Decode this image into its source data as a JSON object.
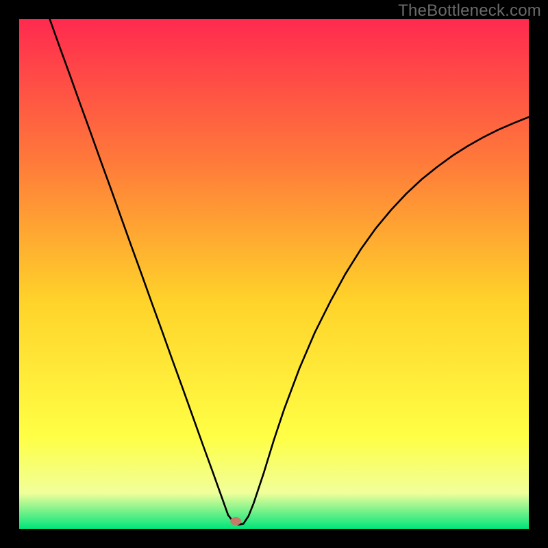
{
  "watermark": "TheBottleneck.com",
  "chart_data": {
    "type": "line",
    "title": "",
    "xlabel": "",
    "ylabel": "",
    "xlim": [
      0,
      100
    ],
    "ylim": [
      0,
      100
    ],
    "grid": false,
    "legend": false,
    "background_gradient": {
      "top": "#ff2a4f",
      "mid_upper": "#ff7a3a",
      "mid": "#ffd22a",
      "mid_lower": "#ffff45",
      "near_bottom": "#f0ff9a",
      "bottom": "#00e57a"
    },
    "annotations": [
      {
        "type": "marker",
        "shape": "ellipse",
        "x": 42.5,
        "y": 1.5,
        "color": "#c57a6a"
      }
    ],
    "series": [
      {
        "name": "curve",
        "color": "#000000",
        "x": [
          6,
          8,
          10,
          12,
          14,
          16,
          18,
          20,
          22,
          24,
          26,
          28,
          30,
          32,
          34,
          36,
          38,
          39.5,
          41,
          42,
          43,
          44,
          45,
          46,
          48,
          50,
          52,
          55,
          58,
          61,
          64,
          67,
          70,
          73,
          76,
          79,
          82,
          85,
          88,
          91,
          94,
          97,
          100
        ],
        "y": [
          100,
          94.4,
          88.9,
          83.3,
          77.8,
          72.2,
          66.7,
          61.1,
          55.5,
          50.0,
          44.4,
          38.9,
          33.3,
          27.8,
          22.2,
          16.6,
          11.1,
          6.9,
          2.7,
          1.4,
          0.8,
          1.0,
          2.5,
          5.0,
          11.0,
          17.5,
          23.5,
          31.5,
          38.5,
          44.5,
          50.0,
          54.8,
          59.0,
          62.6,
          65.8,
          68.6,
          71.0,
          73.2,
          75.1,
          76.8,
          78.3,
          79.6,
          80.8
        ]
      }
    ]
  }
}
